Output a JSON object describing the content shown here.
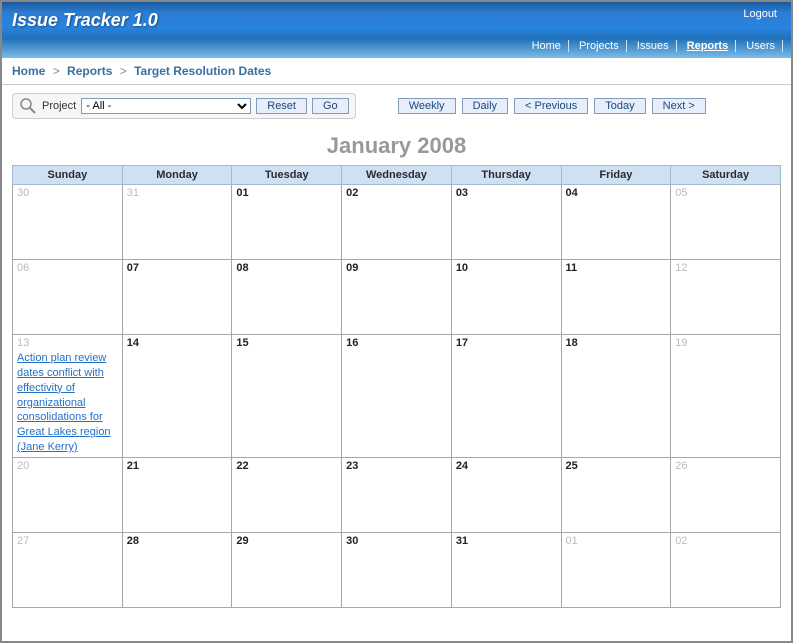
{
  "app_title": "Issue Tracker 1.0",
  "logout_label": "Logout",
  "nav": {
    "home": "Home",
    "projects": "Projects",
    "issues": "Issues",
    "reports": "Reports",
    "users": "Users"
  },
  "breadcrumb": {
    "home": "Home",
    "reports": "Reports",
    "page": "Target Resolution Dates",
    "sep": ">"
  },
  "toolbar": {
    "project_label": "Project",
    "project_value": "- All -",
    "reset": "Reset",
    "go": "Go",
    "weekly": "Weekly",
    "daily": "Daily",
    "previous": "< Previous",
    "today": "Today",
    "next": "Next >"
  },
  "calendar": {
    "title": "January 2008",
    "dow": [
      "Sunday",
      "Monday",
      "Tuesday",
      "Wednesday",
      "Thursday",
      "Friday",
      "Saturday"
    ],
    "weeks": [
      [
        {
          "n": "30",
          "out": true
        },
        {
          "n": "31",
          "out": true
        },
        {
          "n": "01"
        },
        {
          "n": "02"
        },
        {
          "n": "03"
        },
        {
          "n": "04"
        },
        {
          "n": "05",
          "out": true
        }
      ],
      [
        {
          "n": "06",
          "out": true
        },
        {
          "n": "07"
        },
        {
          "n": "08"
        },
        {
          "n": "09"
        },
        {
          "n": "10"
        },
        {
          "n": "11"
        },
        {
          "n": "12",
          "out": true
        }
      ],
      [
        {
          "n": "13",
          "out": true,
          "event": "Action plan review dates conflict with effectivity of organizational consolidations for Great Lakes region (Jane Kerry)"
        },
        {
          "n": "14"
        },
        {
          "n": "15"
        },
        {
          "n": "16"
        },
        {
          "n": "17"
        },
        {
          "n": "18"
        },
        {
          "n": "19",
          "out": true
        }
      ],
      [
        {
          "n": "20",
          "out": true
        },
        {
          "n": "21"
        },
        {
          "n": "22"
        },
        {
          "n": "23"
        },
        {
          "n": "24"
        },
        {
          "n": "25"
        },
        {
          "n": "26",
          "out": true
        }
      ],
      [
        {
          "n": "27",
          "out": true
        },
        {
          "n": "28"
        },
        {
          "n": "29"
        },
        {
          "n": "30"
        },
        {
          "n": "31"
        },
        {
          "n": "01",
          "out": true
        },
        {
          "n": "02",
          "out": true
        }
      ]
    ]
  }
}
